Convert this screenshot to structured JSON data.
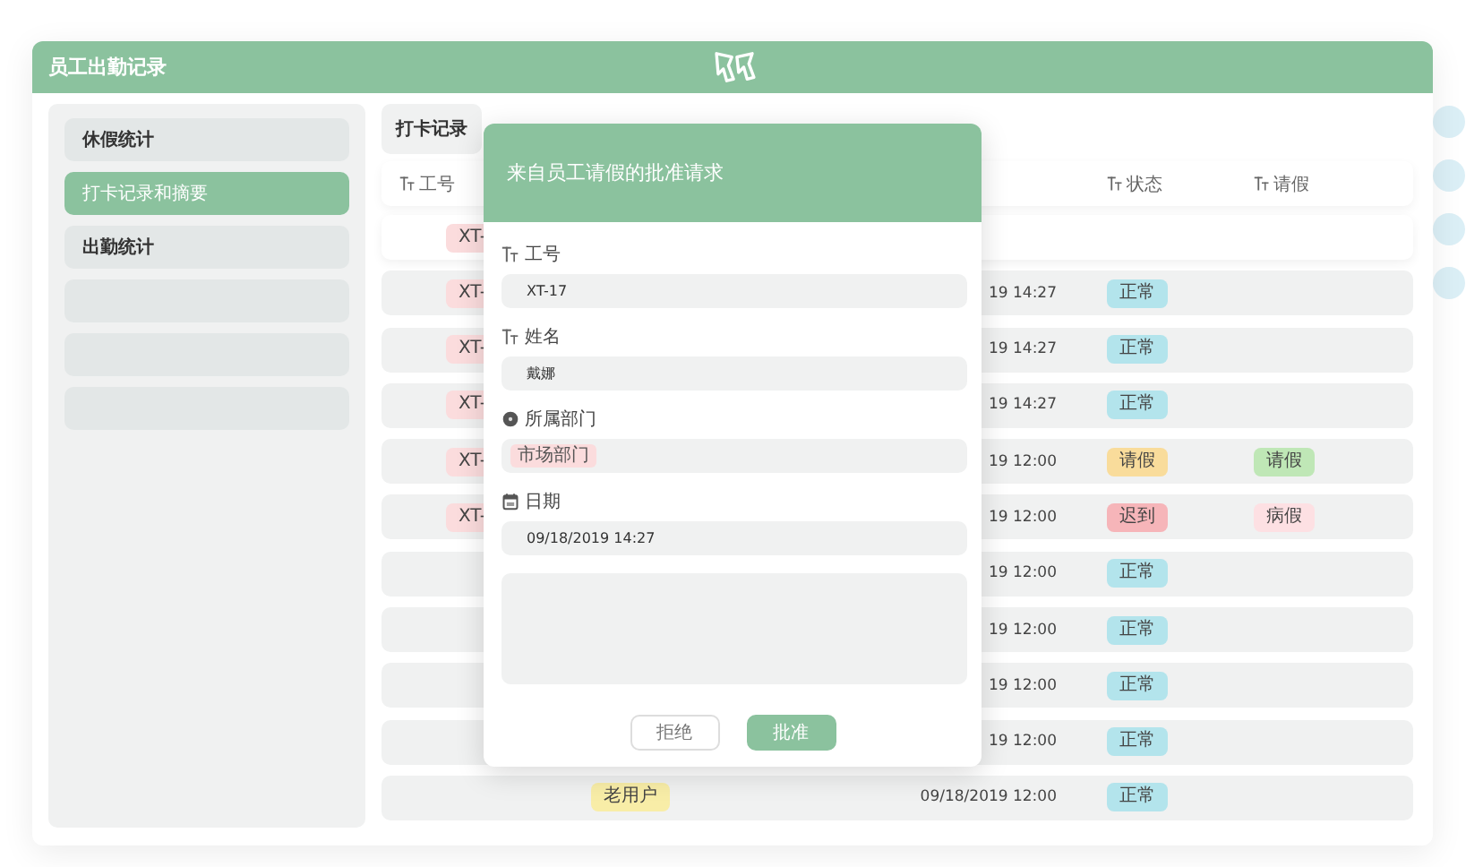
{
  "app": {
    "title": "员工出勤记录"
  },
  "sidebar": {
    "items": [
      {
        "label": "休假统计",
        "selected": false
      },
      {
        "label": "打卡记录和摘要",
        "selected": true
      },
      {
        "label": "出勤统计",
        "selected": false
      },
      {
        "selected": false
      },
      {
        "selected": false
      },
      {
        "selected": false
      }
    ]
  },
  "tabs": [
    {
      "label": "打卡记录",
      "selected": true
    }
  ],
  "table": {
    "columns": [
      {
        "label": "工号",
        "kind": "id"
      },
      {
        "label": "状态",
        "kind": "status"
      },
      {
        "label": "请假",
        "kind": "leave"
      }
    ],
    "rows": [
      {
        "selected": true,
        "tag": {
          "text": "XT-",
          "kind": "id",
          "color": "#fbdcdd"
        }
      },
      {
        "selected": false,
        "tag": {
          "text": "XT-",
          "kind": "id",
          "color": "#fbdcdd"
        },
        "date": "19 14:27",
        "status": {
          "text": "正常",
          "color": "#b3e4ec"
        }
      },
      {
        "selected": false,
        "tag": {
          "text": "XT-",
          "kind": "id",
          "color": "#fbdcdd"
        },
        "date": "19 14:27",
        "status": {
          "text": "正常",
          "color": "#b3e4ec"
        }
      },
      {
        "selected": false,
        "tag": {
          "text": "XT-",
          "kind": "id",
          "color": "#fbdcdd"
        },
        "date": "19 14:27",
        "status": {
          "text": "正常",
          "color": "#b3e4ec"
        }
      },
      {
        "selected": false,
        "tag": {
          "text": "XT-",
          "kind": "id",
          "color": "#fbdcdd"
        },
        "date": "19 12:00",
        "status": {
          "text": "请假",
          "color": "#f9dc9b"
        },
        "leave": {
          "text": "请假",
          "color": "#bfe7b6"
        }
      },
      {
        "selected": false,
        "tag": {
          "text": "XT-",
          "kind": "id",
          "color": "#fbdcdd"
        },
        "date": "19 12:00",
        "status": {
          "text": "迟到",
          "color": "#f6b5b9"
        },
        "leave": {
          "text": "病假",
          "color": "#fde0e3"
        }
      },
      {
        "selected": false,
        "date": "19 12:00",
        "status": {
          "text": "正常",
          "color": "#b3e4ec"
        }
      },
      {
        "selected": false,
        "date": "19 12:00",
        "status": {
          "text": "正常",
          "color": "#b3e4ec"
        }
      },
      {
        "selected": false,
        "date": "19 12:00",
        "status": {
          "text": "正常",
          "color": "#b3e4ec"
        }
      },
      {
        "selected": false,
        "date": "19 12:00",
        "status": {
          "text": "正常",
          "color": "#b3e4ec"
        }
      },
      {
        "selected": false,
        "tag": {
          "text": "老用户",
          "kind": "user",
          "color": "#f8eda7"
        },
        "date": "09/18/2019 12:00",
        "status": {
          "text": "正常",
          "color": "#b3e4ec"
        }
      }
    ]
  },
  "dialog": {
    "title": "来自员工请假的批准请求",
    "fields": [
      {
        "label": "工号",
        "kind": "text",
        "value": "XT-17"
      },
      {
        "label": "姓名",
        "kind": "text",
        "value": "戴娜"
      },
      {
        "label": "所属部门",
        "kind": "select",
        "value": "市场部门"
      },
      {
        "label": "日期",
        "kind": "date",
        "value": "09/18/2019 14:27"
      }
    ],
    "buttons": [
      {
        "label": "拒绝",
        "kind": "secondary"
      },
      {
        "label": "批准",
        "kind": "primary"
      }
    ]
  }
}
